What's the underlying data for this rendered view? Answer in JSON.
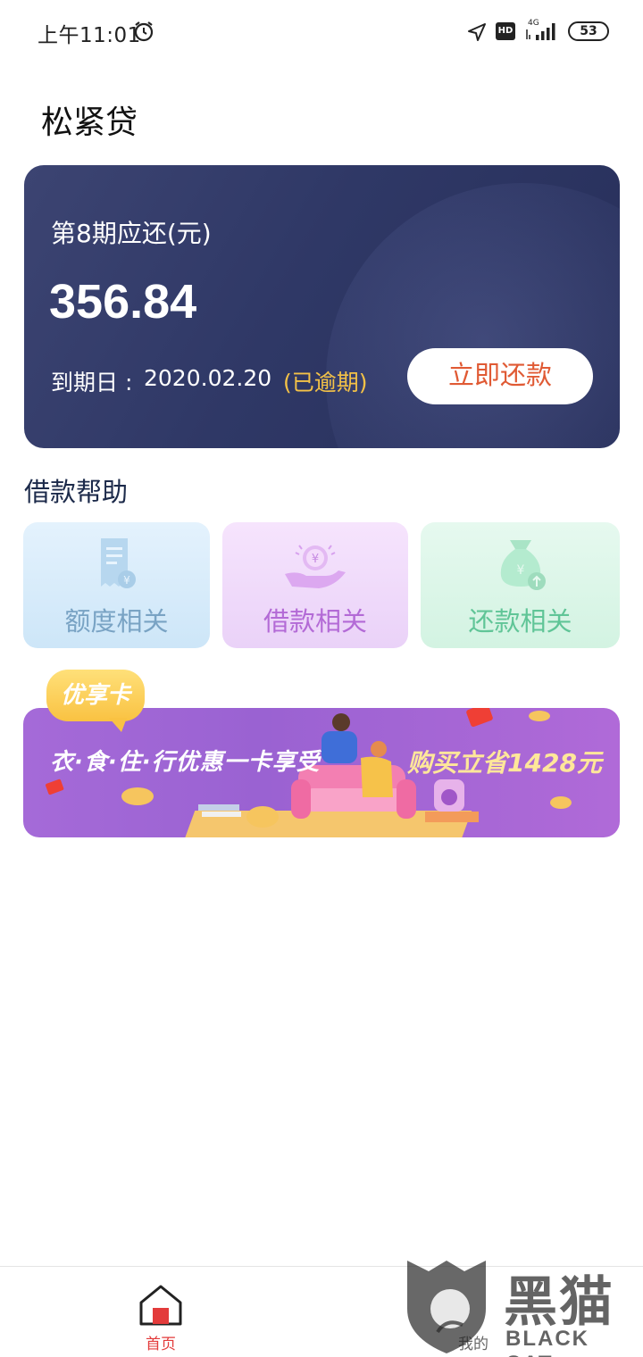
{
  "status_bar": {
    "time": "上午11:01",
    "hd_label": "HD",
    "network": "4G",
    "battery": "53"
  },
  "page": {
    "title": "松紧贷"
  },
  "repay_card": {
    "label": "第8期应还(元)",
    "amount": "356.84",
    "due_label": "到期日 :",
    "due_date": "2020.02.20",
    "status": "(已逾期)",
    "button_label": "立即还款"
  },
  "help": {
    "section_title": "借款帮助",
    "tiles": [
      {
        "label": "额度相关",
        "icon": "receipt-yuan-icon"
      },
      {
        "label": "借款相关",
        "icon": "hand-coin-icon"
      },
      {
        "label": "还款相关",
        "icon": "money-bag-icon"
      }
    ]
  },
  "promo": {
    "tag": "优享卡",
    "slogan": "衣·食·住·行优惠一卡享受",
    "save_text": "购买立省1428元"
  },
  "nav": {
    "items": [
      {
        "label": "首页",
        "icon": "home-icon",
        "active": true
      },
      {
        "label": "我的",
        "icon": "user-icon",
        "active": false
      }
    ]
  },
  "watermark": {
    "cn": "黑猫",
    "en": "BLACK CAT"
  },
  "colors": {
    "card_bg": "#2f3866",
    "accent_red": "#e05a34",
    "overdue_yellow": "#f4c247",
    "nav_active": "#e33b3b"
  }
}
